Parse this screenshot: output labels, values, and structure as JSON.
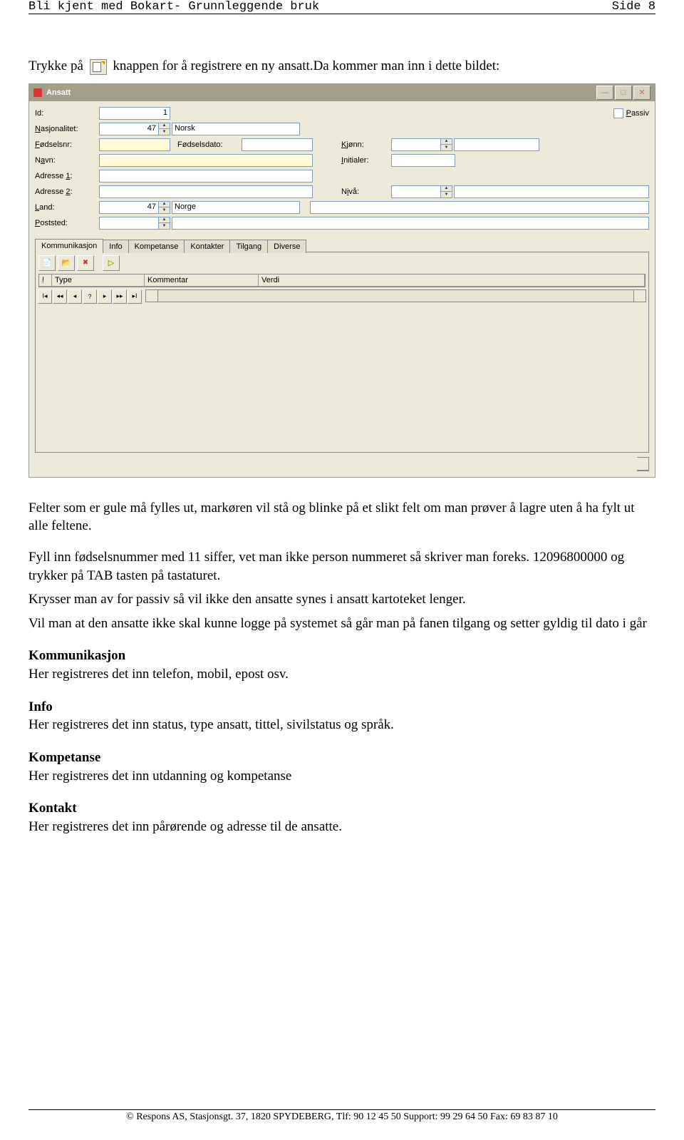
{
  "header": {
    "title": "Bli kjent med Bokart- Grunnleggende bruk",
    "page": "Side 8"
  },
  "intro": {
    "t1": "Trykke på ",
    "t2": " knappen for å registrere en ny ansatt.Da kommer man inn i dette bildet:"
  },
  "win": {
    "title": "Ansatt",
    "passiv": "Passiv",
    "labels": {
      "id": "Id:",
      "nasj": "Nasjonalitet:",
      "fnr": "Fødselsnr:",
      "fdato": "Fødselsdato:",
      "kjonn": "Kjønn:",
      "navn": "Navn:",
      "init": "Initialer:",
      "adr1": "Adresse 1:",
      "adr2": "Adresse 2:",
      "niva": "Nivå:",
      "land": "Land:",
      "post": "Poststed:"
    },
    "values": {
      "id": "1",
      "nasj": "47",
      "nasjtxt": "Norsk",
      "land": "47",
      "landtxt": "Norge"
    },
    "tabs": [
      "Kommunikasjon",
      "Info",
      "Kompetanse",
      "Kontakter",
      "Tilgang",
      "Diverse"
    ],
    "cols": {
      "bang": "!",
      "type": "Type",
      "komm": "Kommentar",
      "verdi": "Verdi"
    }
  },
  "body": {
    "p1": "Felter som er gule må fylles ut, markøren vil stå og blinke på et slikt felt om man prøver å lagre uten å ha fylt ut alle feltene.",
    "p2": "Fyll inn fødselsnummer med 11 siffer, vet man ikke person nummeret  så skriver man foreks. 12096800000 og trykker på TAB tasten på tastaturet.",
    "p3": "Krysser man av for passiv så vil ikke den ansatte synes i ansatt kartoteket lenger.",
    "p4": "Vil man at den ansatte ikke skal kunne logge på systemet så går man på fanen tilgang og setter gyldig til dato i går",
    "h1": "Kommunikasjon",
    "p5": "Her registreres det inn telefon, mobil, epost osv.",
    "h2": "Info",
    "p6": "Her  registreres det inn status, type ansatt, tittel, sivilstatus og språk.",
    "h3": "Kompetanse",
    "p7": "Her registreres det inn utdanning og kompetanse",
    "h4": "Kontakt",
    "p8": "Her registreres det inn pårørende og adresse til de ansatte."
  },
  "footer": "© Respons AS, Stasjonsgt. 37, 1820 SPYDEBERG, Tlf: 90 12 45 50 Support: 99 29 64 50 Fax: 69 83 87 10"
}
